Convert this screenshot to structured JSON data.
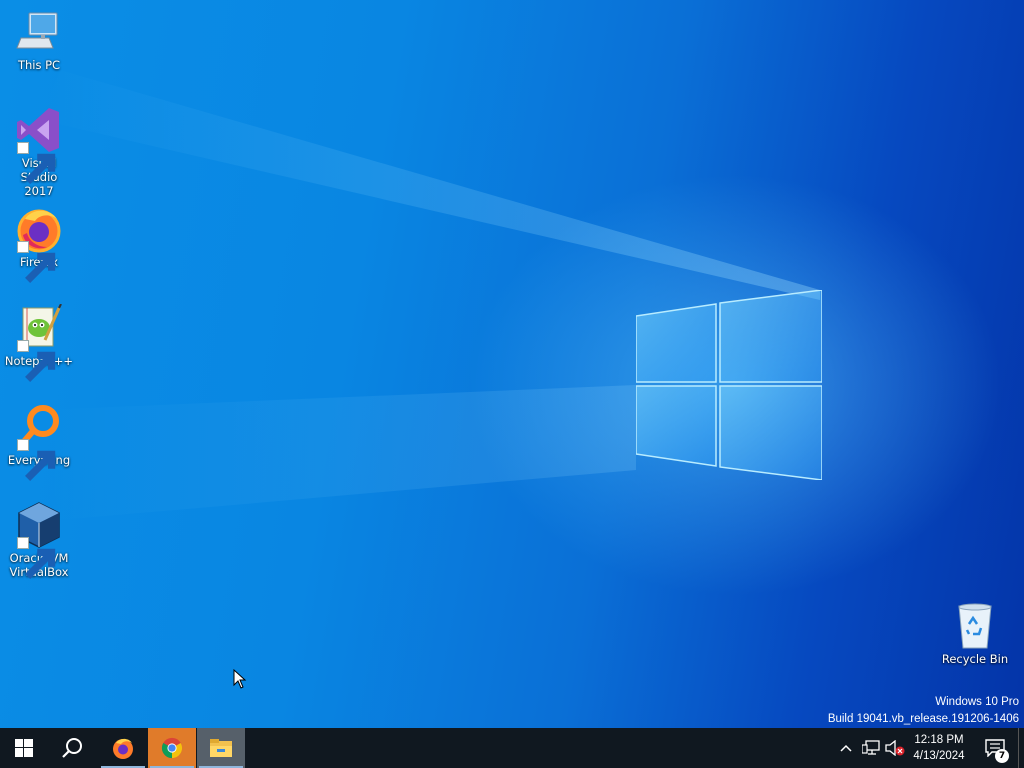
{
  "desktop": {
    "icons": [
      {
        "label_line1": "This PC",
        "label_line2": "",
        "icon": "this-pc-icon"
      },
      {
        "label_line1": "Visual Studio",
        "label_line2": "2017",
        "icon": "visual-studio-icon"
      },
      {
        "label_line1": "Firefox",
        "label_line2": "",
        "icon": "firefox-icon"
      },
      {
        "label_line1": "Notepad++",
        "label_line2": "",
        "icon": "notepadpp-icon"
      },
      {
        "label_line1": "Everything",
        "label_line2": "",
        "icon": "everything-icon"
      },
      {
        "label_line1": "Oracle VM",
        "label_line2": "VirtualBox",
        "icon": "virtualbox-icon"
      }
    ],
    "recycle_bin": {
      "label": "Recycle Bin",
      "icon": "recycle-bin-icon"
    },
    "watermark": {
      "line1": "Windows 10 Pro",
      "line2": "Build 19041.vb_release.191206-1406"
    }
  },
  "taskbar": {
    "buttons": [
      {
        "name": "start",
        "icon": "windows-start-icon"
      },
      {
        "name": "search",
        "icon": "search-icon"
      },
      {
        "name": "firefox",
        "icon": "firefox-icon"
      },
      {
        "name": "chrome",
        "icon": "chrome-icon"
      },
      {
        "name": "file-explorer",
        "icon": "folder-icon"
      }
    ],
    "tray": {
      "icons": [
        "chevron-up-icon",
        "network-icon",
        "volume-muted-icon"
      ],
      "time": "12:18 PM",
      "date": "4/13/2024",
      "notification_count": "7"
    }
  },
  "colors": {
    "taskbar": "#101820",
    "desktop_blue": "#0a86e2",
    "chrome_highlight": "#e07b2a"
  }
}
